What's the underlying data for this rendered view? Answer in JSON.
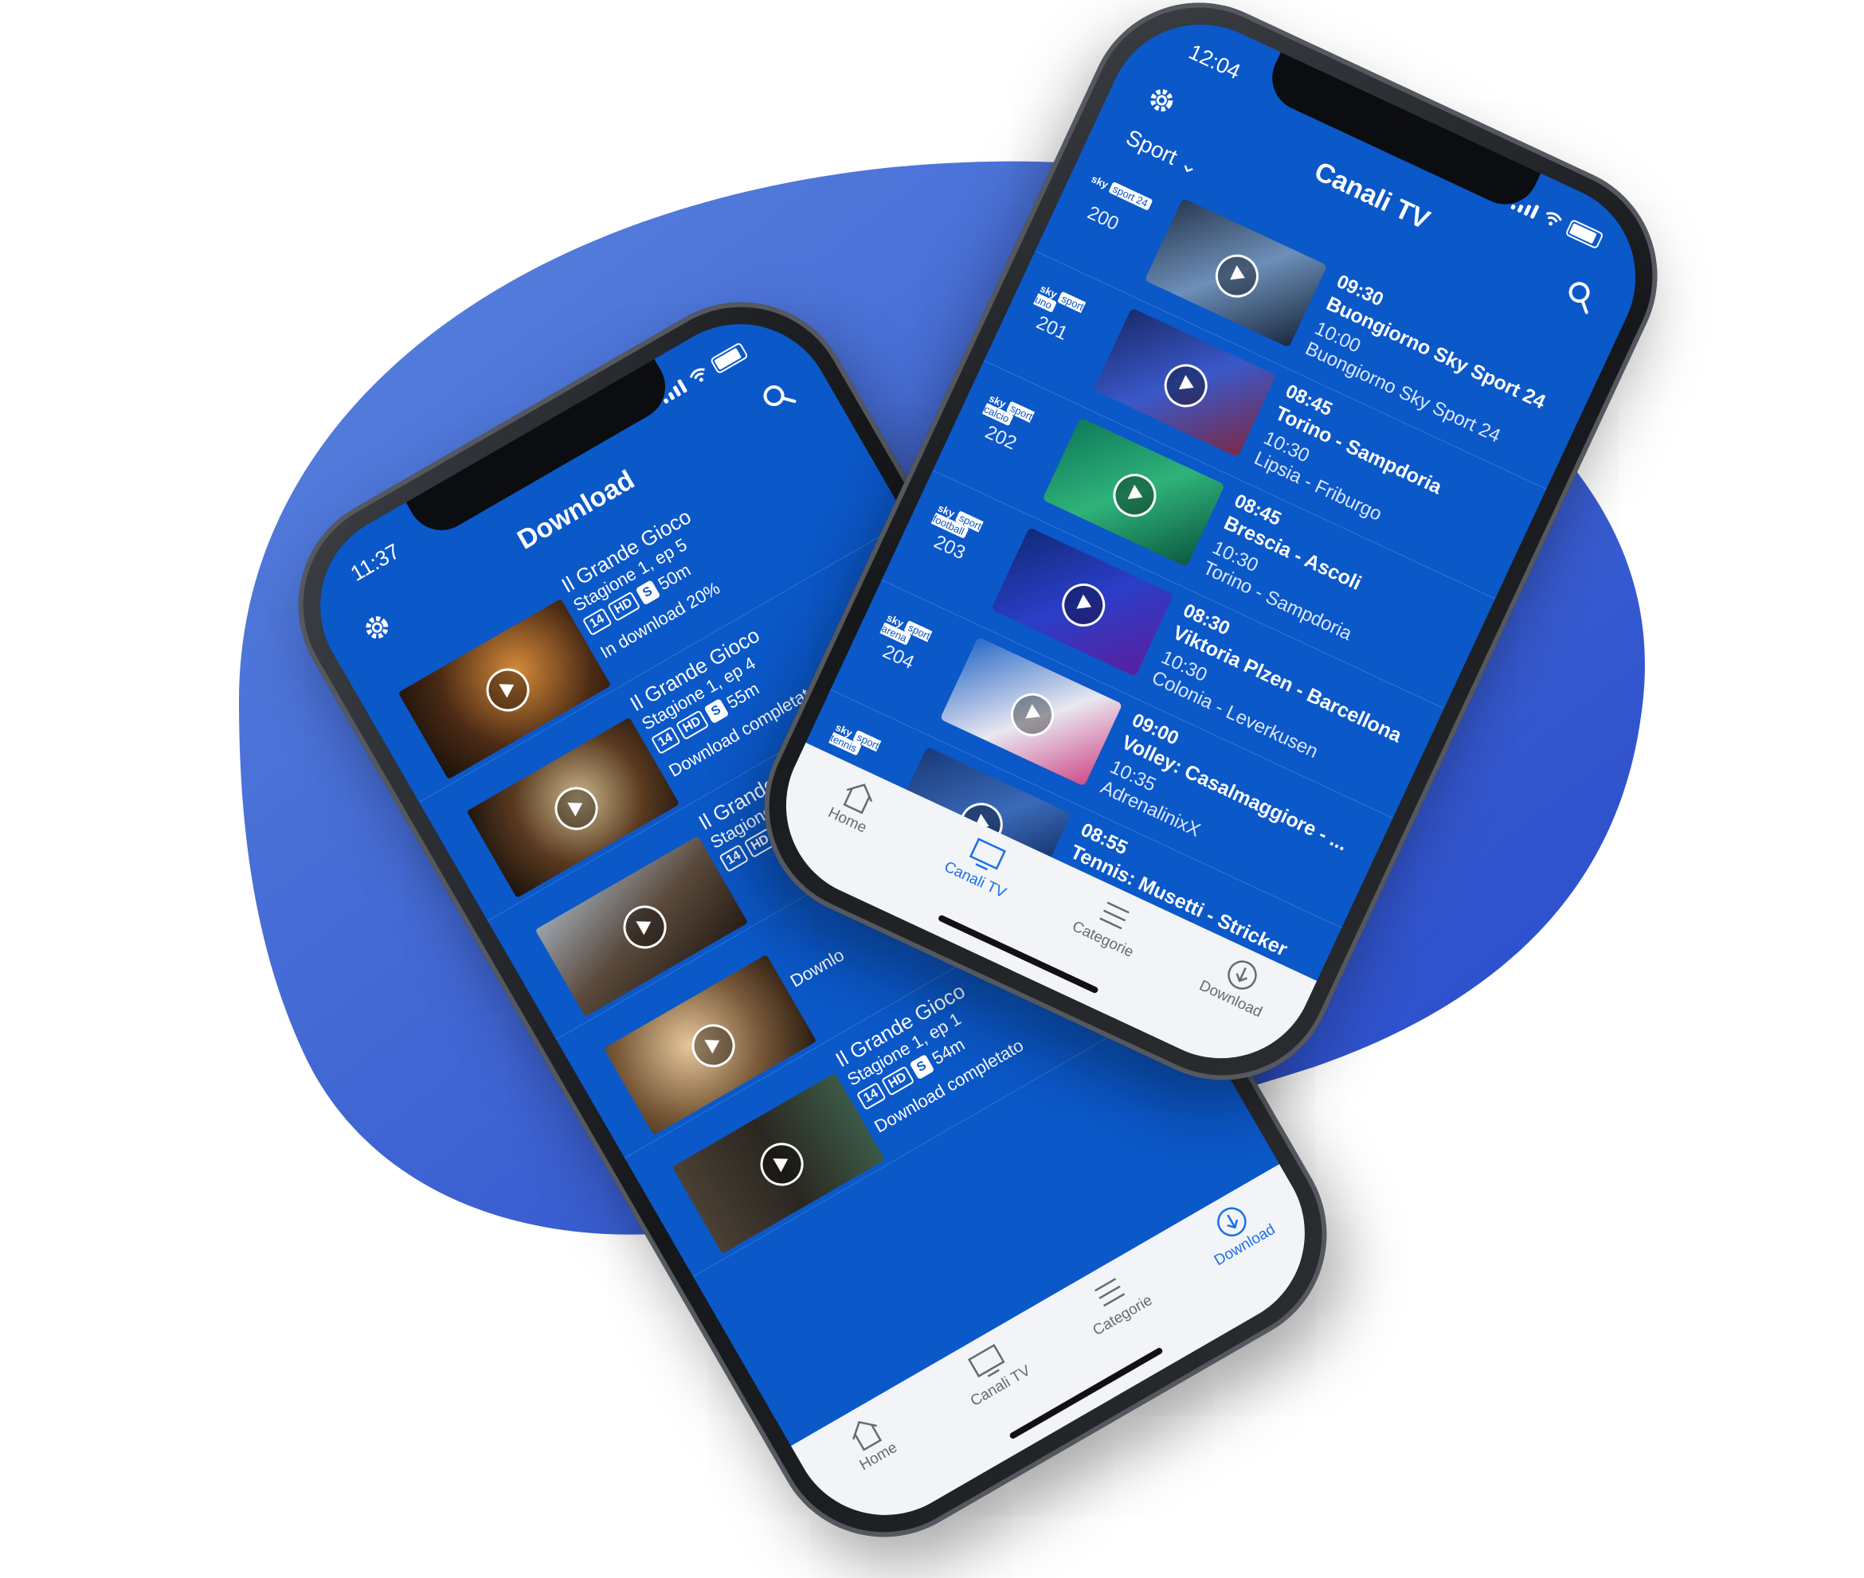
{
  "colors": {
    "blob": "#2f5fd6",
    "screen": "#0b58c9",
    "accent": "#1a6fe8"
  },
  "phone_back": {
    "status": {
      "time": "11:37"
    },
    "header": {
      "title": "Download"
    },
    "items": [
      {
        "title": "Il Grande Gioco",
        "episode": "Stagione 1, ep 5",
        "badges": [
          "14",
          "HD",
          "S"
        ],
        "duration": "50m",
        "status": "In download 20%"
      },
      {
        "title": "Il Grande Gioco",
        "episode": "Stagione 1, ep 4",
        "badges": [
          "14",
          "HD",
          "S"
        ],
        "duration": "55m",
        "status": "Download completato"
      },
      {
        "title": "Il Grande Gio",
        "episode": "Stagione 1",
        "badges": [
          "14",
          "HD"
        ],
        "duration": "",
        "status": ""
      },
      {
        "title": "",
        "episode": "",
        "badges": [],
        "duration": "",
        "status": "Downlo"
      },
      {
        "title": "Il Grande Gioco",
        "episode": "Stagione 1, ep 1",
        "badges": [
          "14",
          "HD",
          "S"
        ],
        "duration": "54m",
        "status": "Download completato"
      }
    ],
    "tabs": [
      {
        "label": "Home",
        "icon": "home-icon"
      },
      {
        "label": "Canali TV",
        "icon": "tv-icon"
      },
      {
        "label": "Categorie",
        "icon": "menu-icon"
      },
      {
        "label": "Download",
        "icon": "download-icon",
        "active": true
      }
    ]
  },
  "phone_front": {
    "status": {
      "time": "12:04"
    },
    "header": {
      "title": "Canali TV"
    },
    "filter": {
      "label": "Sport"
    },
    "channels": [
      {
        "logo": "sky",
        "logo_tag": "sport 24",
        "number": "200",
        "time1": "09:30",
        "title1": "Buongiorno Sky Sport 24",
        "time2": "10:00",
        "title2": "Buongiorno Sky Sport 24"
      },
      {
        "logo": "sky",
        "logo_tag": "sport uno",
        "number": "201",
        "time1": "08:45",
        "title1": "Torino - Sampdoria",
        "time2": "10:30",
        "title2": "Lipsia - Friburgo"
      },
      {
        "logo": "sky",
        "logo_tag": "sport calcio",
        "number": "202",
        "time1": "08:45",
        "title1": "Brescia - Ascoli",
        "time2": "10:30",
        "title2": "Torino - Sampdoria"
      },
      {
        "logo": "sky",
        "logo_tag": "sport football",
        "number": "203",
        "time1": "08:30",
        "title1": "Viktoria Plzen - Barcellona",
        "time2": "10:30",
        "title2": "Colonia - Leverkusen"
      },
      {
        "logo": "sky",
        "logo_tag": "sport arena",
        "number": "204",
        "time1": "09:00",
        "title1": "Volley: Casalmaggiore - ...",
        "time2": "10:35",
        "title2": "AdrenalinixX"
      },
      {
        "logo": "sky",
        "logo_tag": "sport tennis",
        "number": "",
        "time1": "08:55",
        "title1": "Tennis: Musetti - Stricker",
        "time2": "",
        "title2": ""
      }
    ],
    "tabs": [
      {
        "label": "Home",
        "icon": "home-icon"
      },
      {
        "label": "Canali TV",
        "icon": "tv-icon",
        "active": true
      },
      {
        "label": "Categorie",
        "icon": "menu-icon"
      },
      {
        "label": "Download",
        "icon": "download-icon"
      }
    ]
  }
}
